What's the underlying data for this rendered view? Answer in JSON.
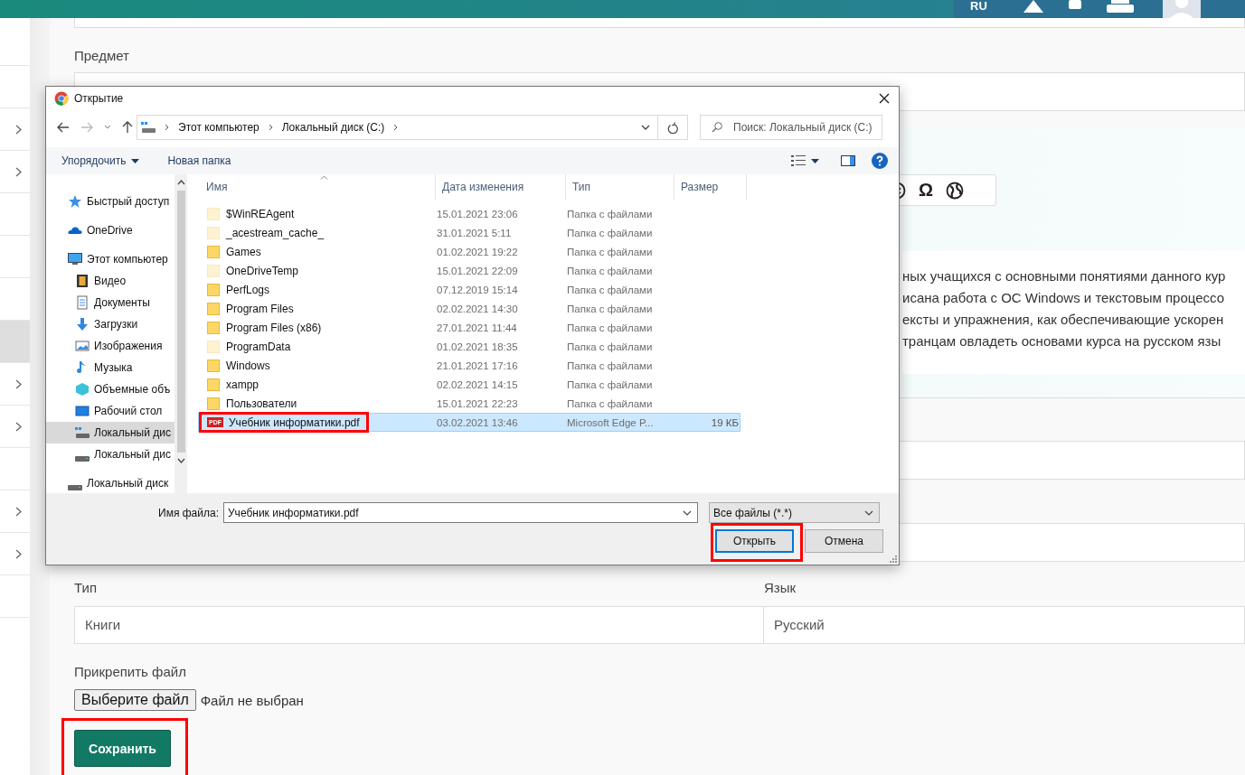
{
  "header": {
    "language": "RU"
  },
  "sidebar": {
    "items": [
      {
        "has_children": false,
        "selected": false
      },
      {
        "has_children": false,
        "selected": false
      },
      {
        "has_children": true,
        "selected": false
      },
      {
        "has_children": true,
        "selected": false
      },
      {
        "has_children": false,
        "selected": false
      },
      {
        "has_children": false,
        "selected": false
      },
      {
        "has_children": false,
        "selected": false
      },
      {
        "has_children": false,
        "selected": true
      },
      {
        "has_children": true,
        "selected": false
      },
      {
        "has_children": true,
        "selected": false
      },
      {
        "has_children": false,
        "selected": false
      },
      {
        "has_children": true,
        "selected": false
      },
      {
        "has_children": true,
        "selected": false
      },
      {
        "has_children": false,
        "selected": false
      }
    ]
  },
  "form": {
    "subject_label": "Предмет",
    "editor_symbol": "Ω",
    "editor_lines": [
      "ных учащихся с основными понятиями данного кур",
      "исана работа с ОС Windows и текстовым процессо",
      "ексты и упражнения, как обеспечивающие ускорен",
      "транцам овладеть основами курса на русском язы"
    ],
    "type_label": "Тип",
    "type_value": "Книги",
    "language_label": "Язык",
    "language_value": "Русский",
    "attach_label": "Прикрепить файл",
    "choose_button": "Выберите файл",
    "no_file": "Файл не выбран",
    "save_button": "Сохранить",
    "save_highlighted": true
  },
  "dialog": {
    "title": "Открытие",
    "breadcrumb": [
      "Этот компьютер",
      "Локальный диск (C:)"
    ],
    "search_placeholder": "Поиск: Локальный диск (C:)",
    "organize": "Упорядочить",
    "new_folder": "Новая папка",
    "nav": [
      {
        "label": "Быстрый доступ",
        "kind": "star",
        "selected": false
      },
      {
        "label": "OneDrive",
        "kind": "cloud",
        "selected": false
      },
      {
        "label": "Этот компьютер",
        "kind": "computer",
        "selected": false,
        "children": [
          {
            "label": "Видео",
            "kind": "video",
            "selected": false
          },
          {
            "label": "Документы",
            "kind": "documents",
            "selected": false
          },
          {
            "label": "Загрузки",
            "kind": "downloads",
            "selected": false
          },
          {
            "label": "Изображения",
            "kind": "pictures",
            "selected": false
          },
          {
            "label": "Музыка",
            "kind": "music",
            "selected": false
          },
          {
            "label": "Объемные объ",
            "kind": "objects",
            "selected": false
          },
          {
            "label": "Рабочий стол",
            "kind": "desktop",
            "selected": false
          },
          {
            "label": "Локальный дис",
            "kind": "system_drive",
            "selected": true
          },
          {
            "label": "Локальный дис",
            "kind": "drive",
            "selected": false
          }
        ]
      },
      {
        "label": "Локальный диск",
        "kind": "drive",
        "selected": false
      }
    ],
    "columns": [
      "Имя",
      "Дата изменения",
      "Тип",
      "Размер"
    ],
    "files": [
      {
        "name": "$WinREAgent",
        "date": "15.01.2021 23:06",
        "type": "Папка с файлами",
        "kind": "folder",
        "hidden": true,
        "selected": false
      },
      {
        "name": "_acestream_cache_",
        "date": "31.01.2021 5:11",
        "type": "Папка с файлами",
        "kind": "folder",
        "hidden": true,
        "selected": false
      },
      {
        "name": "Games",
        "date": "01.02.2021 19:22",
        "type": "Папка с файлами",
        "kind": "folder",
        "hidden": false,
        "selected": false
      },
      {
        "name": "OneDriveTemp",
        "date": "15.01.2021 22:09",
        "type": "Папка с файлами",
        "kind": "folder",
        "hidden": true,
        "selected": false
      },
      {
        "name": "PerfLogs",
        "date": "07.12.2019 15:14",
        "type": "Папка с файлами",
        "kind": "folder",
        "hidden": false,
        "selected": false
      },
      {
        "name": "Program Files",
        "date": "02.02.2021 14:30",
        "type": "Папка с файлами",
        "kind": "folder",
        "hidden": false,
        "selected": false
      },
      {
        "name": "Program Files (x86)",
        "date": "27.01.2021 11:44",
        "type": "Папка с файлами",
        "kind": "folder",
        "hidden": false,
        "selected": false
      },
      {
        "name": "ProgramData",
        "date": "01.02.2021 18:35",
        "type": "Папка с файлами",
        "kind": "folder",
        "hidden": true,
        "selected": false
      },
      {
        "name": "Windows",
        "date": "21.01.2021 17:16",
        "type": "Папка с файлами",
        "kind": "folder",
        "hidden": false,
        "selected": false
      },
      {
        "name": "xampp",
        "date": "02.02.2021 14:15",
        "type": "Папка с файлами",
        "kind": "folder",
        "hidden": false,
        "selected": false
      },
      {
        "name": "Пользователи",
        "date": "15.01.2021 22:23",
        "type": "Папка с файлами",
        "kind": "folder",
        "hidden": false,
        "selected": false
      },
      {
        "name": "Учебник информатики.pdf",
        "date": "03.02.2021 13:46",
        "type": "Microsoft Edge P...",
        "size": "19 КБ",
        "kind": "pdf",
        "selected": true,
        "highlighted": true
      }
    ],
    "pdf_badge": "PDF",
    "filename_label": "Имя файла:",
    "filename_value": "Учебник информатики.pdf",
    "filter": "Все файлы (*.*)",
    "open_button": "Открыть",
    "open_highlighted": true,
    "cancel_button": "Отмена"
  }
}
